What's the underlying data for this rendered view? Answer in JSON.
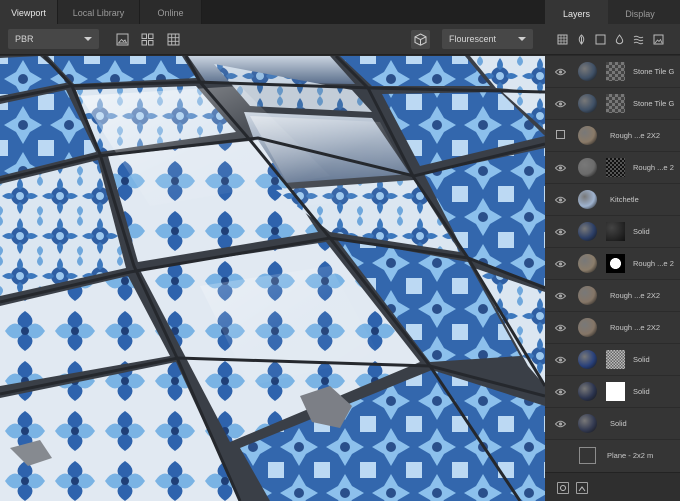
{
  "tabs": [
    {
      "label": "Viewport",
      "active": true
    },
    {
      "label": "Local Library",
      "active": false
    },
    {
      "label": "Online",
      "active": false
    }
  ],
  "viewport_toolbar": {
    "shading_mode": "PBR",
    "environment": "Flourescent",
    "icons": [
      "frame-icon",
      "quad-view-icon",
      "grid-icon",
      "cube-icon"
    ]
  },
  "right_tabs": [
    {
      "label": "Layers",
      "active": true
    },
    {
      "label": "Display",
      "active": false
    }
  ],
  "layer_tools": [
    "texture-icon",
    "leaf-icon",
    "square-icon",
    "drop-icon",
    "waves-icon",
    "image-icon"
  ],
  "layers": [
    {
      "name": "Stone Tile G",
      "visible": true,
      "thumb": "#3f5066",
      "mask": "checker"
    },
    {
      "name": "Stone Tile G",
      "visible": true,
      "thumb": "#3f5066",
      "mask": "checker"
    },
    {
      "name": "Rough ...e 2X2",
      "visible": false,
      "thumb": "#8a7a68",
      "mask": "none"
    },
    {
      "name": "Rough ...e 2",
      "visible": true,
      "thumb": "#6c6c6c",
      "mask": "checker-dark"
    },
    {
      "name": "Kitchetle",
      "visible": true,
      "thumb": "#9fb3cf",
      "mask": "none"
    },
    {
      "name": "Solid",
      "visible": true,
      "thumb": "#2b3e66",
      "mask": "noise"
    },
    {
      "name": "Rough ...e 2",
      "visible": true,
      "thumb": "#8b7d6b",
      "mask": "splat"
    },
    {
      "name": "Rough ...e 2X2",
      "visible": true,
      "thumb": "#857667",
      "mask": "none"
    },
    {
      "name": "Rough ...e 2X2",
      "visible": true,
      "thumb": "#857667",
      "mask": "none"
    },
    {
      "name": "Solid",
      "visible": true,
      "thumb": "#28407a",
      "mask": "noise-light"
    },
    {
      "name": "Solid",
      "visible": true,
      "thumb": "#2c3550",
      "mask": "white"
    },
    {
      "name": "Solid",
      "visible": true,
      "thumb": "#333a52",
      "mask": "none"
    }
  ],
  "plane": {
    "name": "Plane - 2x2 m"
  },
  "colors": {
    "panel": "#353535",
    "tile_blue": "#2f5fa3",
    "tile_light": "#8ec1ea",
    "tile_white": "#dfe7ef",
    "grout": "#2b2e33"
  }
}
